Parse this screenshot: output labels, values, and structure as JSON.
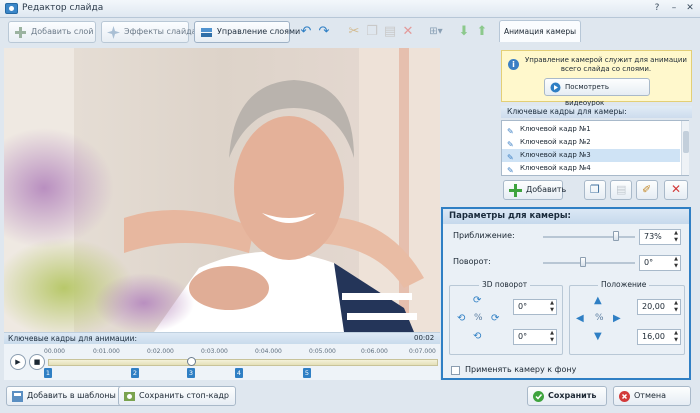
{
  "window": {
    "title": "Редактор слайда"
  },
  "toolbar": {
    "add_layer": "Добавить слой",
    "effects": "Эффекты слайда",
    "manage_layers": "Управление слоями"
  },
  "timeline": {
    "header": "Ключевые кадры для анимации:",
    "time_right": "00:02",
    "ticks": [
      "00.000",
      "0:01.000",
      "0:02.000",
      "0:03.000",
      "0:04.000",
      "0:05.000",
      "0:06.000",
      "0:07.000"
    ],
    "keyframes": [
      "1",
      "2",
      "3",
      "4",
      "5"
    ]
  },
  "camera_tab": {
    "label": "Анимация камеры"
  },
  "info": {
    "text": "Управление камерой служит для анимации всего слайда со слоями.",
    "video_button": "Посмотреть видеоурок"
  },
  "keyframes": {
    "label": "Ключевые кадры для камеры:",
    "items": [
      "Ключевой кадр №1",
      "Ключевой кадр №2",
      "Ключевой кадр №3",
      "Ключевой кадр №4"
    ],
    "selected_index": 2,
    "add_button": "Добавить"
  },
  "params": {
    "header": "Параметры для камеры:",
    "zoom_label": "Приближение:",
    "zoom_value": "73%",
    "rotate_label": "Поворот:",
    "rotate_value": "0°",
    "rotate3d_title": "3D поворот",
    "position_title": "Положение",
    "rot3d_x": "0°",
    "rot3d_y": "0°",
    "pos_x": "20,00",
    "pos_y": "16,00",
    "apply_bg": "Применять камеру к фону"
  },
  "bottom": {
    "templates": "Добавить в шаблоны",
    "save_frame": "Сохранить стоп-кадр",
    "save": "Сохранить",
    "cancel": "Отмена"
  },
  "colors": {
    "accent": "#2f7fc4",
    "info_bg": "#fff8cc"
  }
}
